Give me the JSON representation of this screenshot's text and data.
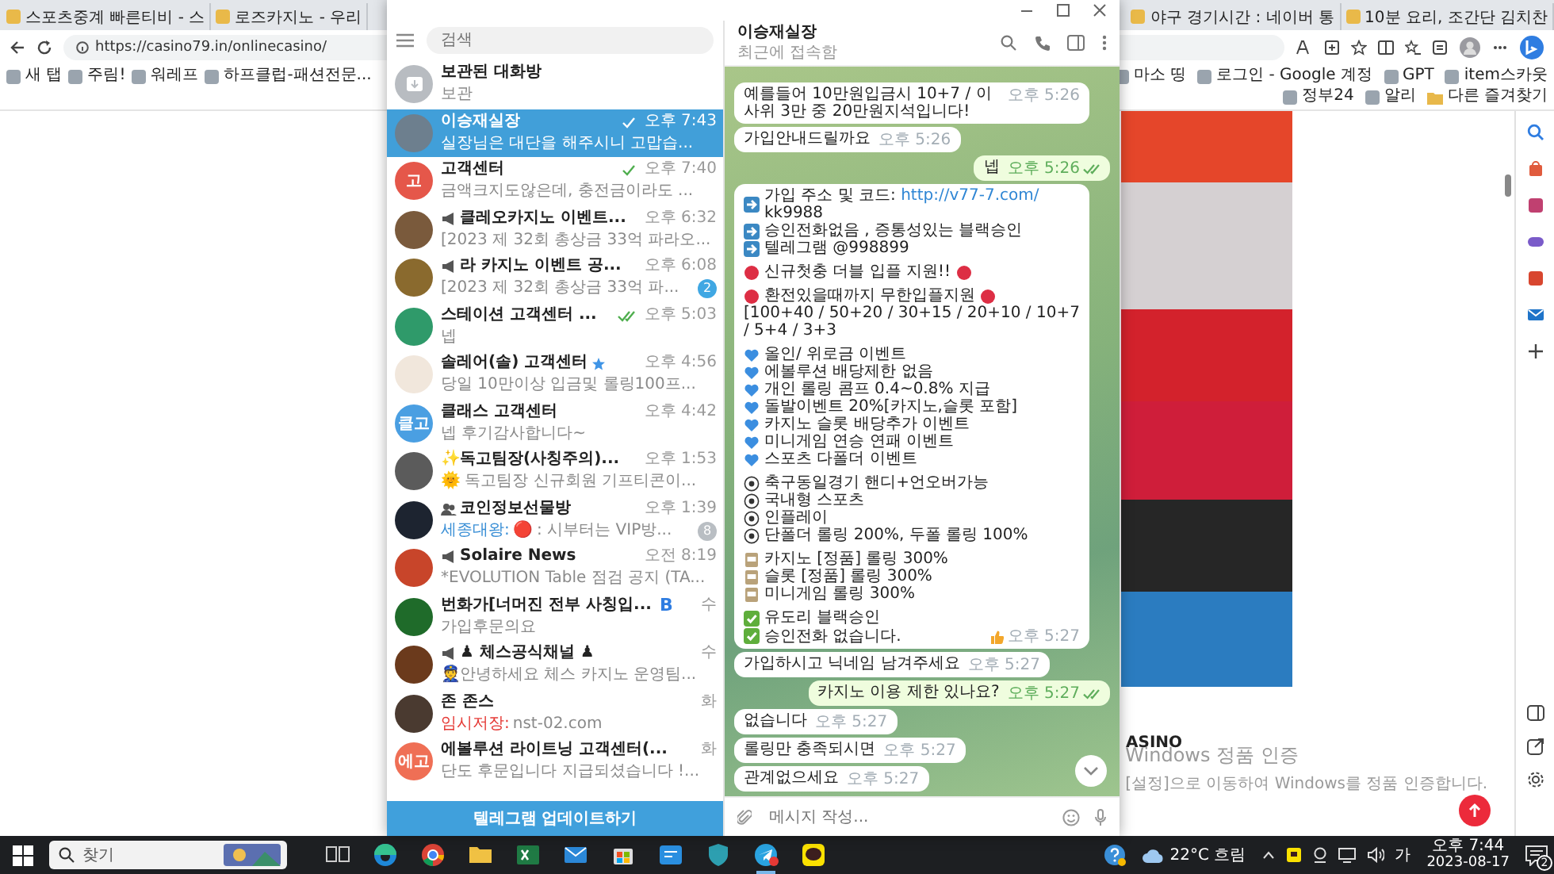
{
  "browser": {
    "tabs_left": [
      {
        "title": "스포츠중계 빠른티비 - 스",
        "selected": false
      },
      {
        "title": "로즈카지노 - 우리",
        "selected": false
      }
    ],
    "tabs_right": [
      {
        "title": "야구 경기시간 : 네이버 통",
        "selected": false
      },
      {
        "title": "10분 요리, 조간단 김치찬",
        "selected": false
      }
    ],
    "url": "https://casino79.in/onlinecasino/",
    "bookmarks_left": [
      {
        "title": "새 탭",
        "kind": "page"
      },
      {
        "title": "주림!",
        "kind": "page"
      },
      {
        "title": "워레프",
        "kind": "page"
      },
      {
        "title": "하프클럽-패션전문...",
        "kind": "page"
      }
    ],
    "bookmarks_right": [
      {
        "title": "마소 띵",
        "kind": "page"
      },
      {
        "title": "로그인 - Google 계정",
        "kind": "page"
      },
      {
        "title": "GPT",
        "kind": "page"
      },
      {
        "title": "item스카웃",
        "kind": "page"
      },
      {
        "title": "정부24",
        "kind": "page"
      },
      {
        "title": "알리",
        "kind": "page"
      },
      {
        "title": "다른 즐겨찾기",
        "kind": "folder"
      }
    ]
  },
  "page": {
    "side_text": "ASINO"
  },
  "activation_notice": {
    "title": "Windows 정품 인증",
    "text": "[설정]으로 이동하여 Windows를 정품 인증합니다."
  },
  "telegram": {
    "search_placeholder": "검색",
    "chats": [
      {
        "kind": "chat",
        "name": "보관된 대화방",
        "preview": "보관",
        "selected": false,
        "sent": false,
        "read": false,
        "verified": false,
        "avatar": {
          "kind": "archive",
          "color": "#b8bcc1"
        }
      },
      {
        "kind": "chat",
        "name": "이승재실장",
        "time": "오후 7:43",
        "preview": "실장님은 대단을 해주시니 고맙습...",
        "selected": true,
        "sent": true,
        "read": false,
        "verified": false,
        "avatar": {
          "kind": "photo",
          "color": "#6d7f8e"
        }
      },
      {
        "kind": "chat",
        "name": "고객센터",
        "time": "오후 7:40",
        "preview": "금액크지도않은데, 충전금이라도 ...",
        "selected": false,
        "sent": true,
        "read": false,
        "verified": false,
        "avatar": {
          "kind": "initials",
          "text": "고",
          "color": "#e5574a"
        }
      },
      {
        "kind": "channel",
        "name": "클레오카지노 이벤트...",
        "time": "오후 6:32",
        "preview": "[2023 제 32회 총상금 33억 파라오...",
        "selected": false,
        "sent": false,
        "read": false,
        "verified": false,
        "avatar": {
          "kind": "photo",
          "color": "#7a5a3c"
        }
      },
      {
        "kind": "channel",
        "name": "라 카지노 이벤트 공...",
        "time": "오후 6:08",
        "preview": "[2023 제 32회 총상금 33억 파...",
        "unread": {
          "count": "2",
          "muted": false
        },
        "selected": false,
        "sent": false,
        "read": false,
        "verified": false,
        "avatar": {
          "kind": "photo",
          "color": "#8a6a2e"
        }
      },
      {
        "kind": "chat",
        "name": "스테이션 고객센터 ...",
        "time": "오후 5:03",
        "preview": "넵",
        "selected": false,
        "sent": true,
        "read": true,
        "verified": false,
        "avatar": {
          "kind": "photo",
          "color": "#2f9a6a"
        }
      },
      {
        "kind": "chat",
        "name": "솔레어(솔) 고객센터",
        "time": "오후 4:56",
        "preview": "당일 10만이상 입금및 롤링100프...",
        "selected": false,
        "sent": false,
        "read": false,
        "verified": true,
        "avatar": {
          "kind": "photo",
          "color": "#f1e7dc"
        }
      },
      {
        "kind": "chat",
        "name": "클래스 고객센터",
        "time": "오후 4:42",
        "preview": "넵 후기감사합니다~",
        "selected": false,
        "sent": false,
        "read": false,
        "verified": false,
        "avatar": {
          "kind": "initials",
          "text": "클고",
          "color": "#4a9fe2"
        }
      },
      {
        "kind": "chat",
        "name": "✨독고팀장(사칭주의)...",
        "time": "오후 1:53",
        "preview": "🌞 독고팀장 신규회원 기프티콘이...",
        "selected": false,
        "sent": false,
        "read": false,
        "verified": false,
        "avatar": {
          "kind": "photo",
          "color": "#5b5b5b"
        }
      },
      {
        "kind": "group",
        "name": "코인정보선물방",
        "time": "오후 1:39",
        "preview_prefix": {
          "kind": "sender",
          "text": "세종대왕:"
        },
        "preview": "🔴 : 시부터는 VIP방...",
        "unread": {
          "count": "8",
          "muted": true
        },
        "selected": false,
        "sent": false,
        "read": false,
        "verified": false,
        "avatar": {
          "kind": "photo",
          "color": "#1d2430"
        }
      },
      {
        "kind": "channel",
        "name": "Solaire News",
        "time": "오전 8:19",
        "preview": "*EVOLUTION Table 점검 공지 (TA...",
        "selected": false,
        "sent": false,
        "read": false,
        "verified": false,
        "avatar": {
          "kind": "photo",
          "color": "#c8452a"
        }
      },
      {
        "kind": "chat",
        "name": "번화가[너머진 전부 사칭입...",
        "tag": "B",
        "time": "수",
        "preview": "가입후문의요",
        "selected": false,
        "sent": false,
        "read": false,
        "verified": false,
        "avatar": {
          "kind": "photo",
          "color": "#1f6b2a"
        }
      },
      {
        "kind": "channel",
        "name": "♟ 체스공식채널 ♟",
        "time": "수",
        "preview": "👮안녕하세요 체스 카지노 운영팀...",
        "selected": false,
        "sent": false,
        "read": false,
        "verified": false,
        "avatar": {
          "kind": "photo",
          "color": "#6b3a1c"
        }
      },
      {
        "kind": "chat",
        "name": "존 존스",
        "time": "화",
        "preview_prefix": {
          "kind": "draft",
          "text": "임시저장:"
        },
        "preview": "nst-02.com",
        "selected": false,
        "sent": false,
        "read": false,
        "verified": false,
        "avatar": {
          "kind": "photo",
          "color": "#4a3a30"
        }
      },
      {
        "kind": "chat",
        "name": "에볼루션 라이트닝 고객센터(...",
        "time": "화",
        "preview": "단도 후문입니다 지급되셨습니다 !...",
        "selected": false,
        "sent": false,
        "read": false,
        "verified": false,
        "avatar": {
          "kind": "initials",
          "text": "에고",
          "color": "#ef6f55"
        }
      }
    ],
    "update_button": "텔레그램 업데이트하기",
    "chat": {
      "name": "이승재실장",
      "status": "최근에 접속함",
      "messages": [
        {
          "outgoing": false,
          "text": "예를들어 10만원입금시 10+7 / 이사위 3만 중 20만원지석입니다!",
          "time": "오후 5:26",
          "read": false,
          "liked": false
        },
        {
          "outgoing": false,
          "text": "가입안내드릴까요",
          "time": "오후 5:26",
          "read": false,
          "liked": false
        },
        {
          "outgoing": true,
          "text": "넵",
          "time": "오후 5:26",
          "read": true,
          "liked": false
        },
        {
          "outgoing": false,
          "time": "오후 5:27",
          "read": false,
          "liked": true,
          "lines": [
            {
              "kind": "arrow",
              "text": "가입 주소 및 코드:",
              "link": "http://v77-7.com/",
              "after": "kk9988"
            },
            {
              "kind": "arrow",
              "text": "승인전화없음 , 증통성있는 블랙승인"
            },
            {
              "kind": "arrow",
              "text": "텔레그램 @998899"
            },
            {
              "kind": "blank"
            },
            {
              "kind": "dot",
              "text": "신규첫충 더블 입플 지원!!"
            },
            {
              "kind": "blank"
            },
            {
              "kind": "dot",
              "text": "환전있을때까지 무한입플지원"
            },
            {
              "kind": "plain",
              "text": "[100+40 / 50+20 / 30+15 / 20+10 / 10+7 / 5+4 / 3+3"
            },
            {
              "kind": "blank"
            },
            {
              "kind": "heart",
              "text": "올인/ 위로금 이벤트"
            },
            {
              "kind": "heart",
              "text": "에볼루션 배당제한 없음"
            },
            {
              "kind": "heart",
              "text": "개인 롤링 콤프 0.4~0.8% 지급"
            },
            {
              "kind": "heart",
              "text": "돌발이벤트 20%[카지노,슬롯 포함]"
            },
            {
              "kind": "heart",
              "text": "카지노 슬롯 배당추가 이벤트"
            },
            {
              "kind": "heart",
              "text": "미니게임 연승 연패 이벤트"
            },
            {
              "kind": "heart",
              "text": "스포츠 다폴더 이벤트"
            },
            {
              "kind": "blank"
            },
            {
              "kind": "ball",
              "text": "축구동일경기 핸디+언오버가능"
            },
            {
              "kind": "ball",
              "text": "국내형 스포츠"
            },
            {
              "kind": "ball",
              "text": "인플레이"
            },
            {
              "kind": "ball",
              "text": "단폴더 롤링 200%, 두폴 롤링 100%"
            },
            {
              "kind": "blank"
            },
            {
              "kind": "slot",
              "text": "카지노 [정품] 롤링 300%"
            },
            {
              "kind": "slot",
              "text": "슬롯 [정품] 롤링 300%"
            },
            {
              "kind": "slot",
              "text": "미니게임 롤링 300%"
            },
            {
              "kind": "blank"
            },
            {
              "kind": "check",
              "text": "유도리 블랙승인"
            },
            {
              "kind": "check",
              "text": "승인전화 없습니다."
            }
          ]
        },
        {
          "outgoing": false,
          "text": "가입하시고 닉네임 남겨주세요",
          "time": "오후 5:27",
          "read": false,
          "liked": false
        },
        {
          "outgoing": true,
          "text": "카지노 이용 제한 있나요?",
          "time": "오후 5:27",
          "read": true,
          "liked": false
        },
        {
          "outgoing": false,
          "text": "없습니다",
          "time": "오후 5:27",
          "read": false,
          "liked": false
        },
        {
          "outgoing": false,
          "text": "롤링만 충족되시면",
          "time": "오후 5:27",
          "read": false,
          "liked": false
        },
        {
          "outgoing": false,
          "text": "관계없으세요",
          "time": "오후 5:27",
          "read": false,
          "liked": false
        }
      ],
      "composer_placeholder": "메시지 작성..."
    }
  },
  "taskbar": {
    "search_placeholder": "찾기",
    "weather": "22°C 흐림",
    "ime": "가",
    "time": "오후 7:44",
    "date": "2023-08-17",
    "notifications": "2"
  }
}
